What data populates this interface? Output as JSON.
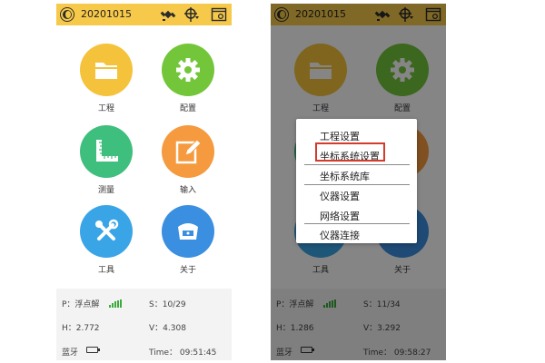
{
  "screens": [
    {
      "topbar": {
        "date": "20201015",
        "icons": [
          "logo-icon",
          "satellite-icon",
          "pole-target-icon",
          "settings-window-icon"
        ]
      },
      "apps": [
        {
          "label": "工程",
          "icon": "folder-icon",
          "color": "#f5c23b"
        },
        {
          "label": "配置",
          "icon": "gear-icon",
          "color": "#73c63a"
        },
        {
          "label": "测量",
          "icon": "ruler-icon",
          "color": "#3fbf7d"
        },
        {
          "label": "输入",
          "icon": "edit-icon",
          "color": "#f59a3e"
        },
        {
          "label": "工具",
          "icon": "tools-icon",
          "color": "#3aa5e6"
        },
        {
          "label": "关于",
          "icon": "receiver-icon",
          "color": "#3a8fe0"
        }
      ],
      "status": {
        "p": "P：浮点解",
        "s": "S：10/29",
        "h": "H：2.772",
        "v": "V：4.308",
        "bluetooth": "蓝牙",
        "time": "Time： 09:51:45"
      }
    },
    {
      "topbar": {
        "date": "20201015"
      },
      "apps": [
        {
          "label": "工程"
        },
        {
          "label": "配置"
        },
        {
          "label": "工具"
        },
        {
          "label": "关于"
        }
      ],
      "status": {
        "p": "P：浮点解",
        "s": "S：11/34",
        "h": "H：1.286",
        "v": "V：3.292",
        "bluetooth": "蓝牙",
        "time": "Time： 09:58:27"
      },
      "menu": {
        "items": [
          "工程设置",
          "坐标系统设置",
          "坐标系统库",
          "仪器设置",
          "网络设置",
          "仪器连接"
        ],
        "highlighted": "坐标系统设置"
      }
    }
  ],
  "colors": {
    "topbar": "#f6c94a",
    "status_bg": "#f3f3f3",
    "signal": "#3daa3d",
    "highlight_border": "#d43a2e"
  }
}
